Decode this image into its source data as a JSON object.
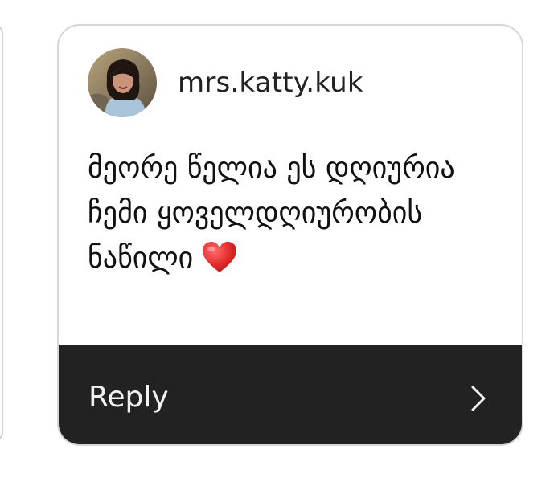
{
  "story_reply": {
    "username": "mrs.katty.kuk",
    "avatar_icon": "user-avatar-photo",
    "message": "მეორე წელია ეს დღიურია ჩემი ყოველდღიურობის ნაწილი",
    "emoji_icon": "red-heart-icon",
    "reply_label": "Reply",
    "reply_icon": "chevron-right-icon"
  },
  "colors": {
    "reply_bar": "#222222",
    "heart": "#e02a2a"
  }
}
